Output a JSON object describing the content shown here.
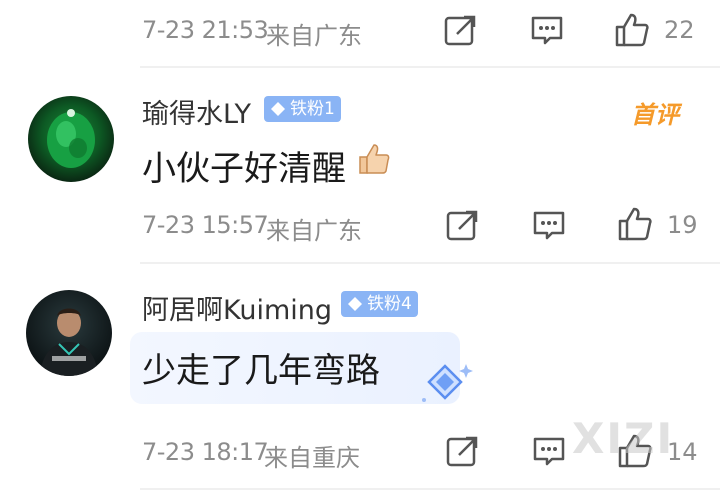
{
  "comments": [
    {
      "time": "7-23 21:53",
      "location": "来自广东",
      "likes": "22"
    },
    {
      "username": "瑜得水LY",
      "badge": "铁粉1",
      "tag": "首评",
      "text": "小伙子好清醒",
      "emoji": "thumbs-up-emoji",
      "time": "7-23 15:57",
      "location": "来自广东",
      "likes": "19"
    },
    {
      "username": "阿居啊Kuiming",
      "badge": "铁粉4",
      "text": "少走了几年弯路",
      "time": "7-23 18:17",
      "location": "来自重庆",
      "likes": "14"
    }
  ],
  "watermark": "XIZI",
  "colors": {
    "accent_badge": "#8ab4f5",
    "first_comment_tag": "#f59a2a",
    "meta_text": "#8c8c8c"
  }
}
